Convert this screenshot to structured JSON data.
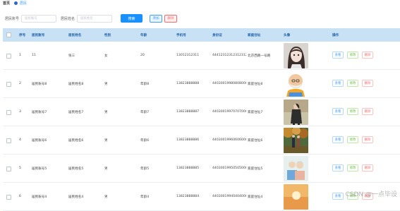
{
  "breadcrumb": {
    "home": "首页",
    "current": "居民"
  },
  "search": {
    "account_label": "居民账号",
    "account_placeholder": "居民账号",
    "name_label": "居民姓名",
    "name_placeholder": "居民姓名",
    "search_button": "搜索",
    "add_button": "添加",
    "delete_button": "删除"
  },
  "table": {
    "headers": [
      "序号",
      "居民账号",
      "居民姓名",
      "性别",
      "年龄",
      "手机号",
      "身份证",
      "家庭住址",
      "头像",
      "操作"
    ],
    "rows": [
      {
        "index": "1",
        "account": "11",
        "name": "张三",
        "gender": "女",
        "age": "20",
        "phone": "13012312311",
        "id_card": "4441231231231231231",
        "address": "北京西路一号路",
        "avatar": "anime-girl"
      },
      {
        "index": "2",
        "account": "居民账号8",
        "name": "居民姓名8",
        "gender": "男",
        "age": "年龄8",
        "phone": "13823888888",
        "id_card": "440300199808080000",
        "address": "家庭住址8",
        "avatar": "bald-cartoon"
      },
      {
        "index": "3",
        "account": "居民账号7",
        "name": "居民姓名7",
        "gender": "男",
        "age": "年龄7",
        "phone": "13823888887",
        "id_card": "440300199707070007",
        "address": "家庭住址7",
        "avatar": "person-dark"
      },
      {
        "index": "4",
        "account": "居民账号6",
        "name": "居民姓名6",
        "gender": "男",
        "age": "年龄6",
        "phone": "13823888886",
        "id_card": "440300199606060006",
        "address": "家庭住址6",
        "avatar": "autumn-couple"
      },
      {
        "index": "5",
        "account": "居民账号5",
        "name": "居民姓名5",
        "gender": "男",
        "age": "年龄5",
        "phone": "13823888885",
        "id_card": "440300199505050005",
        "address": "家庭住址5",
        "avatar": "elderly-couple"
      },
      {
        "index": "6",
        "account": "居民账号4",
        "name": "居民姓名4",
        "gender": "男",
        "age": "年龄4",
        "phone": "13823888884",
        "id_card": "440300199404040004",
        "address": "家庭住址4",
        "avatar": "sunset"
      }
    ],
    "ops": {
      "view": "查看",
      "edit": "修改",
      "delete": "删除"
    }
  },
  "watermark": "CSDN @一点毕设"
}
